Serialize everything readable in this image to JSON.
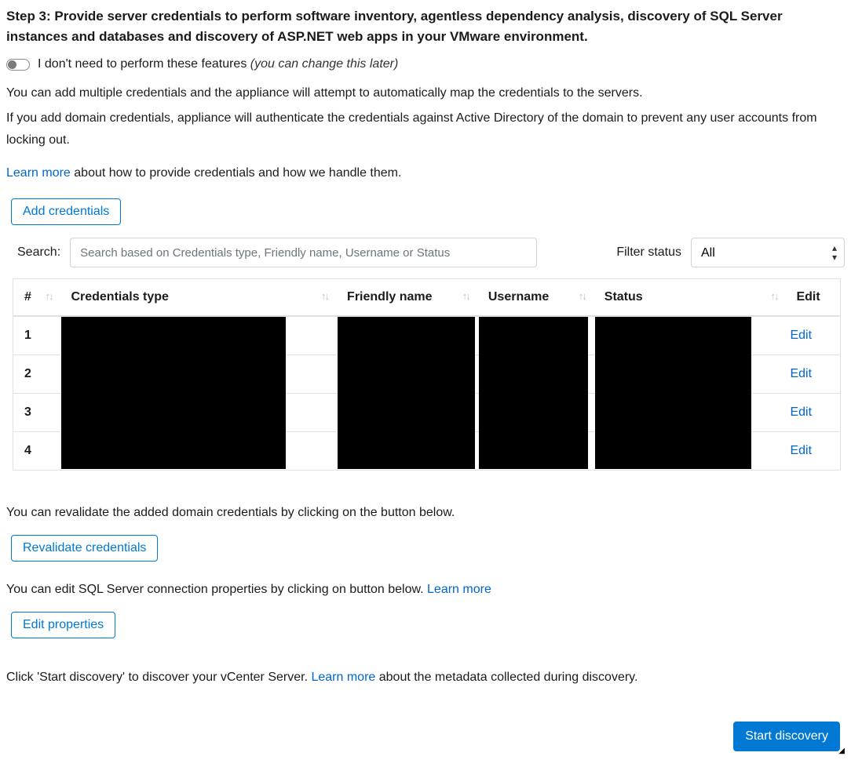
{
  "heading": "Step 3: Provide server credentials to perform software inventory, agentless dependency analysis, discovery of SQL Server instances and databases and discovery of ASP.NET web apps in your VMware environment.",
  "toggle": {
    "label": "I don't need to perform these features ",
    "hint": "(you can change this later)"
  },
  "intro": {
    "line1": "You can add multiple credentials and the appliance will attempt to automatically map the credentials to the servers.",
    "line2": "If you add domain credentials, appliance will authenticate the credentials against Active Directory of the domain to prevent any user accounts from locking out.",
    "learn_more": "Learn more",
    "learn_more_suffix": " about how to provide credentials and how we handle them."
  },
  "buttons": {
    "add_credentials": "Add credentials",
    "revalidate": "Revalidate credentials",
    "edit_properties": "Edit properties",
    "start_discovery": "Start discovery"
  },
  "search": {
    "label": "Search:",
    "placeholder": "Search based on Credentials type, Friendly name, Username or Status"
  },
  "filter": {
    "label": "Filter status",
    "selected": "All"
  },
  "table": {
    "headers": {
      "num": "#",
      "type": "Credentials type",
      "friendly": "Friendly name",
      "user": "Username",
      "status": "Status",
      "edit": "Edit"
    },
    "rows": [
      {
        "num": "1",
        "edit": "Edit"
      },
      {
        "num": "2",
        "edit": "Edit"
      },
      {
        "num": "3",
        "edit": "Edit"
      },
      {
        "num": "4",
        "edit": "Edit"
      }
    ]
  },
  "revalidate_text": "You can revalidate the added domain credentials by clicking on the button below.",
  "sql_text_prefix": "You can edit SQL Server connection properties by clicking on button below. ",
  "sql_learn_more": "Learn more",
  "discovery_text_prefix": "Click 'Start discovery' to discover your vCenter Server. ",
  "discovery_learn_more": "Learn more",
  "discovery_text_suffix": " about the metadata collected during discovery."
}
